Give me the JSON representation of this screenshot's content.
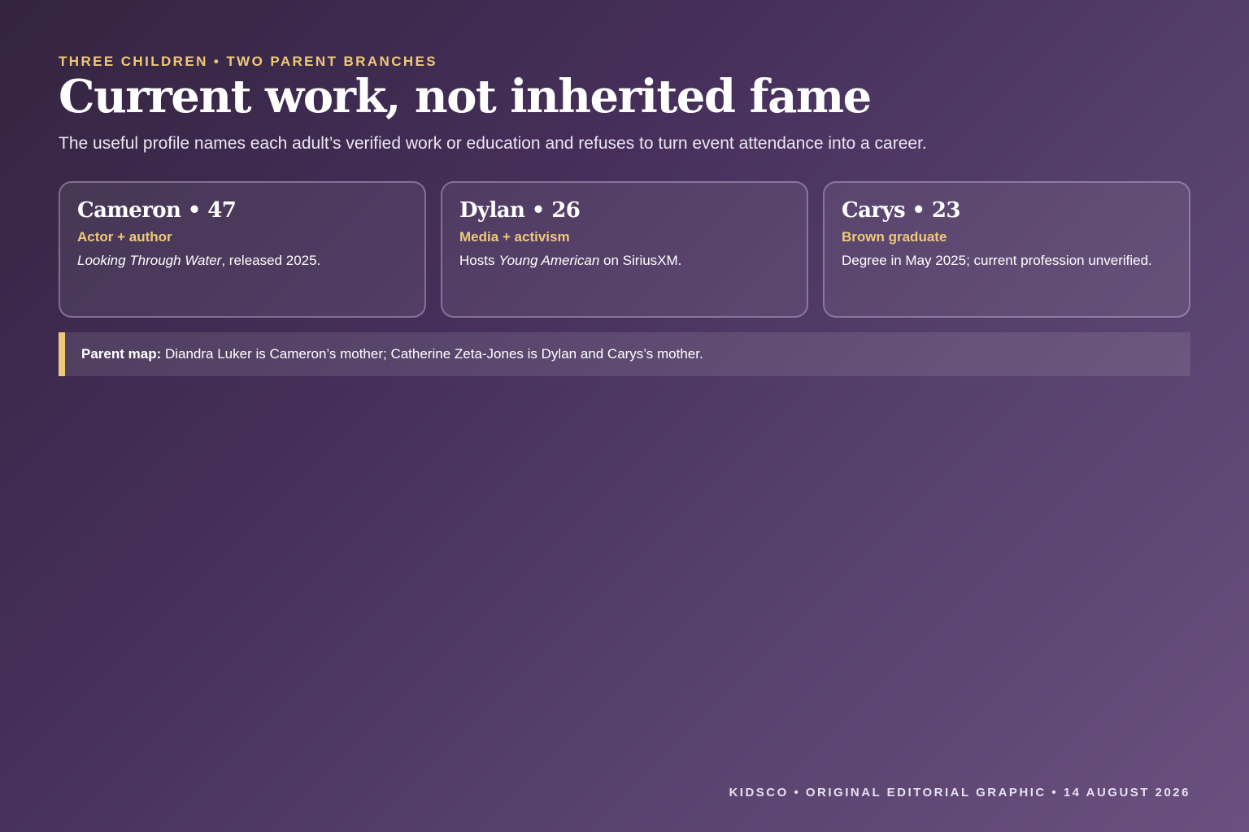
{
  "header": {
    "kicker": "THREE CHILDREN • TWO PARENT BRANCHES",
    "title": "Current work, not inherited fame",
    "subtitle": "The useful profile names each adult’s verified work or education and refuses to turn event attendance into a career."
  },
  "cards": [
    {
      "name": "Cameron • 47",
      "role": "Actor + author",
      "desc_italic": "Looking Through Water",
      "desc_text": ", released 2025."
    },
    {
      "name": "Dylan • 26",
      "role": "Media + activism",
      "desc_prefix": "Hosts ",
      "desc_italic": "Young American",
      "desc_text": " on SiriusXM."
    },
    {
      "name": "Carys • 23",
      "role": "Brown graduate",
      "desc_text": "Degree in May 2025; current profession unverified."
    }
  ],
  "note": {
    "label": "Parent map:",
    "text": " Diandra Luker is Cameron’s mother; Catherine Zeta-Jones is Dylan and Carys’s mother."
  },
  "footer": {
    "text": "KIDSCO • ORIGINAL EDITORIAL GRAPHIC • 14 AUGUST 2026"
  },
  "colors": {
    "accent": "#f0c978",
    "background_start": "#33243f",
    "background_end": "#6a507e"
  }
}
